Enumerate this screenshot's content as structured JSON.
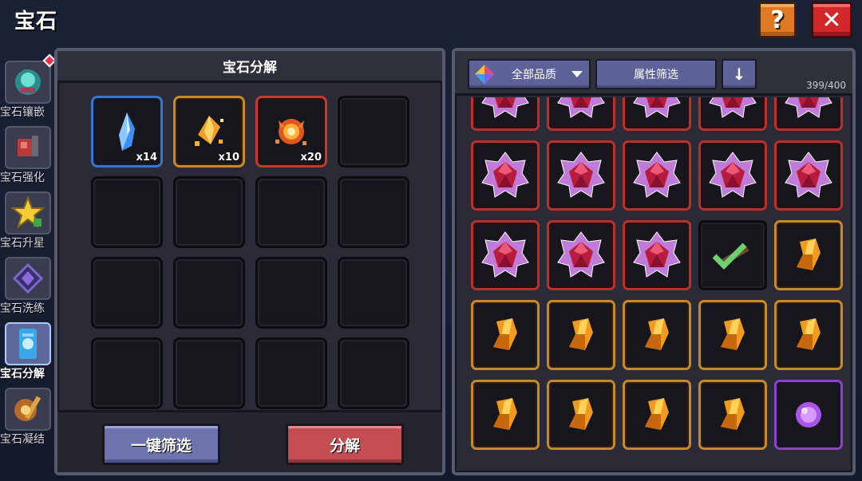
{
  "header": {
    "title": "宝石"
  },
  "side_tabs": [
    {
      "label": "宝石镶嵌",
      "icon": "gem-socket-icon",
      "active": false
    },
    {
      "label": "宝石强化",
      "icon": "gem-enhance-icon",
      "active": false
    },
    {
      "label": "宝石升星",
      "icon": "star-upgrade-icon",
      "active": false
    },
    {
      "label": "宝石洗练",
      "icon": "gem-refine-icon",
      "active": false
    },
    {
      "label": "宝石分解",
      "icon": "gem-decompose-icon",
      "active": true
    },
    {
      "label": "宝石凝结",
      "icon": "gem-condense-icon",
      "active": false
    }
  ],
  "decompose_panel": {
    "title": "宝石分解",
    "slots": [
      {
        "item": "blue-crystal-icon",
        "quality": "blue",
        "count": "x14"
      },
      {
        "item": "orange-shard-icon",
        "quality": "orange",
        "count": "x10"
      },
      {
        "item": "fire-essence-icon",
        "quality": "red",
        "count": "x20"
      }
    ],
    "empty_slots": 13,
    "filter_button": "一键筛选",
    "decompose_button": "分解"
  },
  "inventory_panel": {
    "quality_dropdown": "全部品质",
    "attribute_filter": "属性筛选",
    "sort_icon": "down-arrow-icon",
    "capacity": "399/400",
    "rows": [
      [
        "red-gem",
        "red-gem",
        "red-gem",
        "red-gem",
        "red-gem"
      ],
      [
        "red-gem",
        "red-gem",
        "red-gem",
        "red-gem",
        "red-gem"
      ],
      [
        "red-gem",
        "red-gem",
        "red-gem",
        "checkmark-selected",
        "orange-scroll"
      ],
      [
        "orange-scroll",
        "orange-scroll",
        "orange-scroll",
        "orange-scroll",
        "orange-scroll"
      ],
      [
        "orange-scroll",
        "orange-scroll",
        "orange-scroll",
        "orange-scroll",
        "purple-orb"
      ]
    ]
  },
  "colors": {
    "quality_blue": "#3b75c9",
    "quality_orange": "#c98a2c",
    "quality_red": "#c13a33",
    "quality_purple": "#8a46c9",
    "filter_button": "#6d73ad",
    "decompose_button": "#c44d52",
    "help_button": "#e07a22",
    "close_button": "#d3282a"
  }
}
